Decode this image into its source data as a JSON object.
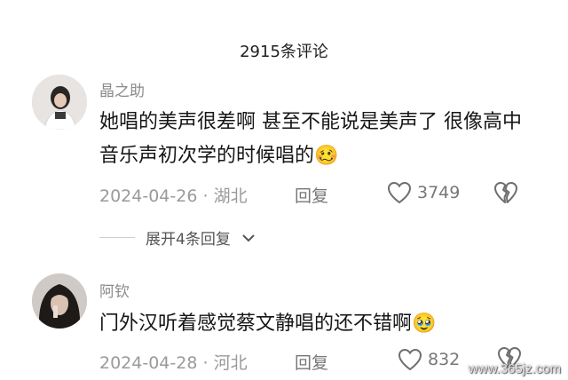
{
  "header": {
    "title": "2915条评论"
  },
  "comments": [
    {
      "username": "晶之助",
      "text": "她唱的美声很差啊 甚至不能说是美声了 很像高中音乐声初次学的时候唱的",
      "emoji": "🥴",
      "date": "2024-04-26",
      "location": "湖北",
      "reply_label": "回复",
      "likes": "3749",
      "expand_label": "展开4条回复"
    },
    {
      "username": "阿钦",
      "text": "门外汉听着感觉蔡文静唱的还不错啊",
      "emoji": "🥹",
      "date": "2024-04-28",
      "location": "河北",
      "reply_label": "回复",
      "likes": "832"
    }
  ],
  "watermark": "www.365jz.com",
  "colors": {
    "text": "#161616",
    "meta": "#9a9a9a",
    "icon": "#6e6e6e"
  }
}
